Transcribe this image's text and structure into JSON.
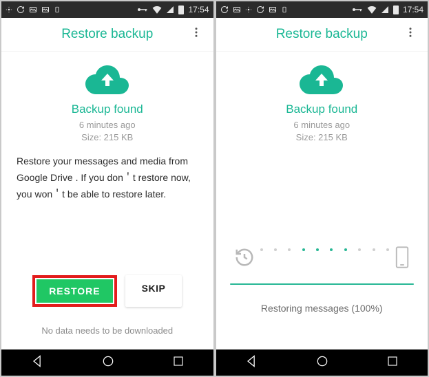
{
  "colors": {
    "accent": "#1ab794",
    "restoreBtn": "#20c764",
    "highlight": "#e31c1c"
  },
  "status": {
    "time": "17:54"
  },
  "header": {
    "title": "Restore backup"
  },
  "backup": {
    "heading": "Backup found",
    "age": "6 minutes ago",
    "size": "Size: 215 KB"
  },
  "screenA": {
    "prompt": "Restore your messages and media from Google Drive . If you don＇t restore now, you won＇t be able to restore later.",
    "restore_label": "RESTORE",
    "skip_label": "SKIP",
    "footer": "No data needs to be downloaded"
  },
  "screenB": {
    "progress_text": "Restoring messages (100%)"
  }
}
